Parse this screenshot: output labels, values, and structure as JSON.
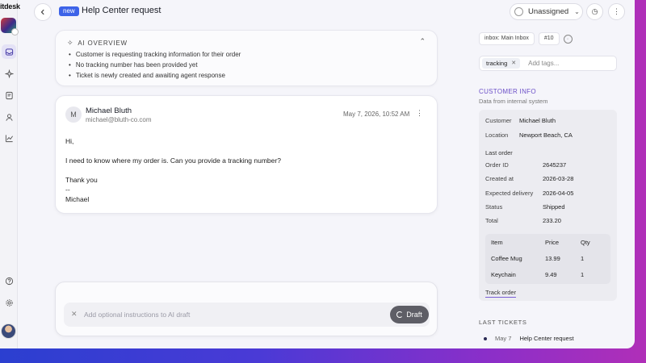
{
  "brand": "itdesk",
  "header": {
    "status_badge": "new",
    "title": "Help Center request",
    "assignee": "Unassigned"
  },
  "ai_overview": {
    "heading": "AI OVERVIEW",
    "points": [
      "Customer is requesting tracking information for their order",
      "No tracking number has been provided yet",
      "Ticket is newly created and awaiting agent response"
    ]
  },
  "message": {
    "avatar_initial": "M",
    "sender_name": "Michael Bluth",
    "sender_email": "michael@bluth-co.com",
    "date": "May 7, 2026, 10:52 AM",
    "lines": [
      "Hi,",
      "I need to know where my order is. Can you provide a tracking number?",
      "Thank you",
      "--",
      "Michael"
    ]
  },
  "composer": {
    "placeholder": "Add optional instructions to AI draft",
    "draft_label": "Draft"
  },
  "right_panel": {
    "inbox_chip": "inbox: Main Inbox",
    "ticket_number": "#10",
    "tag": "tracking",
    "add_tags_placeholder": "Add tags...",
    "customer_info_title": "CUSTOMER INFO",
    "customer_info_sub": "Data from internal system",
    "customer_label": "Customer",
    "customer_value": "Michael Bluth",
    "location_label": "Location",
    "location_value": "Newport Beach, CA",
    "last_order_label": "Last order",
    "order_fields": [
      {
        "label": "Order ID",
        "value": "2645237"
      },
      {
        "label": "Created at",
        "value": "2026-03-28"
      },
      {
        "label": "Expected delivery",
        "value": "2026-04-05"
      },
      {
        "label": "Status",
        "value": "Shipped"
      },
      {
        "label": "Total",
        "value": "233.20"
      }
    ],
    "items_headers": [
      "Item",
      "Price",
      "Qty"
    ],
    "items": [
      {
        "item": "Coffee Mug",
        "price": "13.99",
        "qty": "1"
      },
      {
        "item": "Keychain",
        "price": "9.49",
        "qty": "1"
      }
    ],
    "track_order": "Track order",
    "last_tickets_title": "LAST TICKETS",
    "last_ticket": {
      "date": "May 7",
      "title": "Help Center request"
    }
  }
}
